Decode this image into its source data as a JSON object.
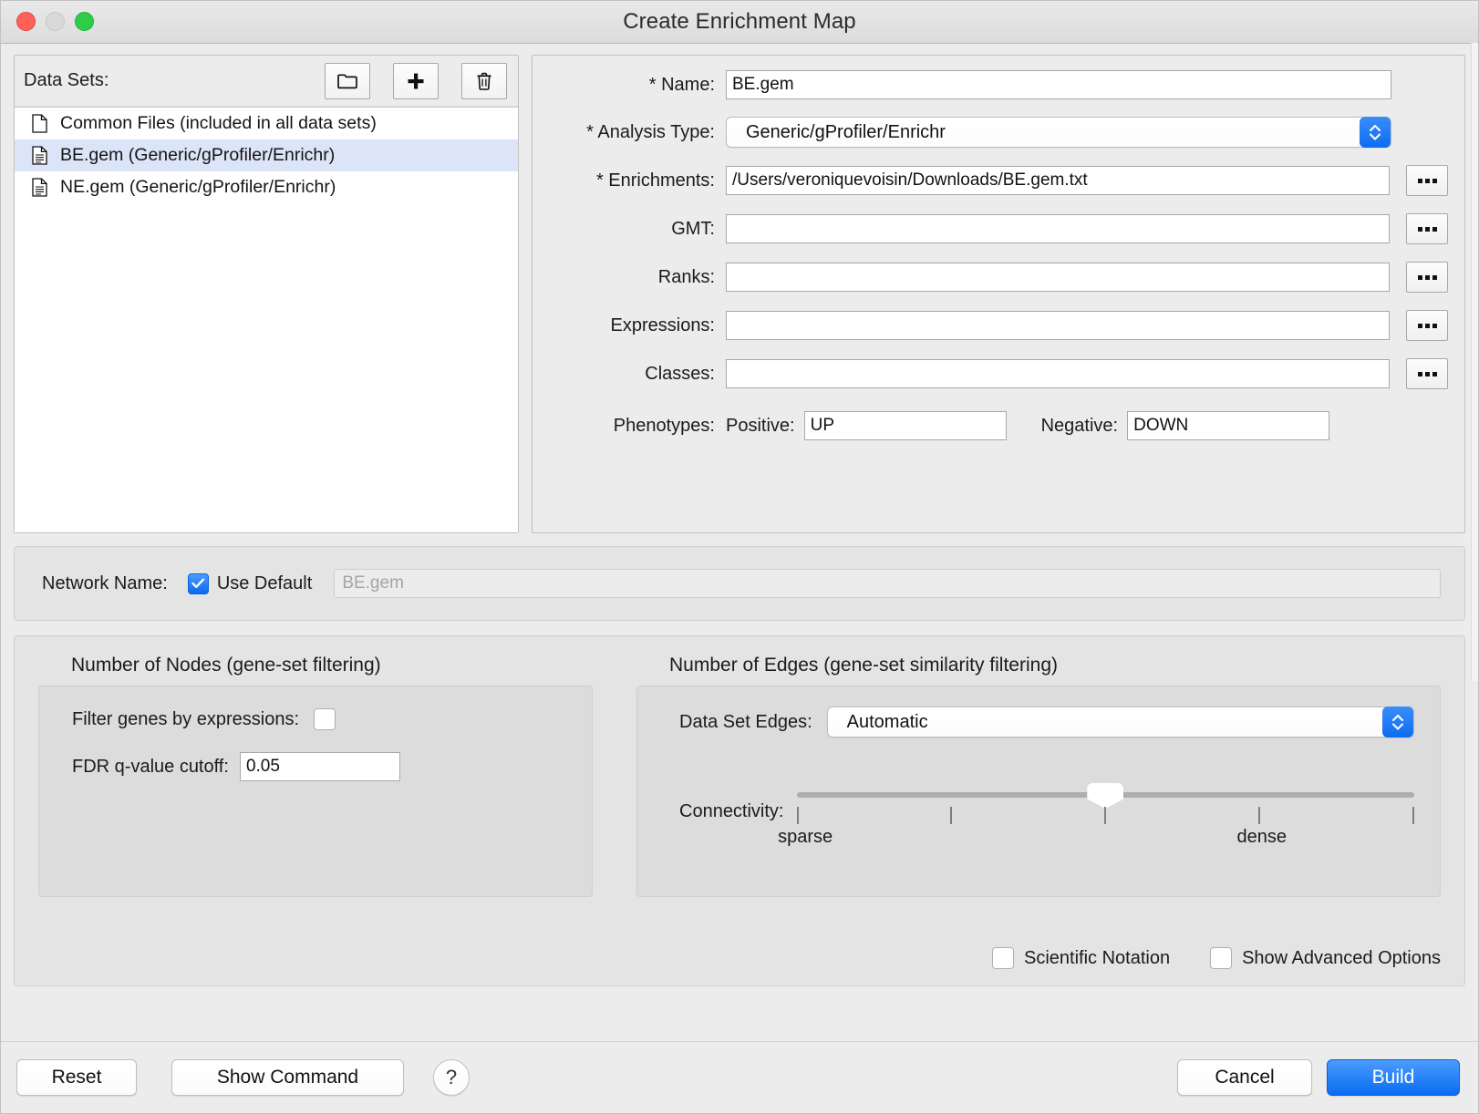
{
  "window": {
    "title": "Create Enrichment Map",
    "traffic_lights": [
      "close",
      "minimize",
      "zoom"
    ]
  },
  "datasets": {
    "label": "Data Sets:",
    "toolbar": [
      {
        "name": "open-folder-button",
        "icon": "folder-icon"
      },
      {
        "name": "add-dataset-button",
        "icon": "plus-icon"
      },
      {
        "name": "delete-dataset-button",
        "icon": "trash-icon"
      }
    ],
    "items": [
      {
        "label": "Common Files (included in all data sets)",
        "icon": "blank-file-icon",
        "selected": false
      },
      {
        "label": "BE.gem  (Generic/gProfiler/Enrichr)",
        "icon": "text-file-icon",
        "selected": true
      },
      {
        "label": "NE.gem  (Generic/gProfiler/Enrichr)",
        "icon": "text-file-icon",
        "selected": false
      }
    ]
  },
  "form": {
    "name": {
      "label": "* Name:",
      "value": "BE.gem"
    },
    "analysis_type": {
      "label": "* Analysis Type:",
      "value": "Generic/gProfiler/Enrichr",
      "options": [
        "Generic/gProfiler/Enrichr"
      ]
    },
    "enrichments": {
      "label": "* Enrichments:",
      "value": "/Users/veroniquevoisin/Downloads/BE.gem.txt",
      "browse": "..."
    },
    "gmt": {
      "label": "GMT:",
      "value": "",
      "browse": "..."
    },
    "ranks": {
      "label": "Ranks:",
      "value": "",
      "browse": "..."
    },
    "expressions": {
      "label": "Expressions:",
      "value": "",
      "browse": "..."
    },
    "classes": {
      "label": "Classes:",
      "value": "",
      "browse": "..."
    },
    "phenotypes": {
      "label": "Phenotypes:",
      "positive_label": "Positive:",
      "positive_value": "UP",
      "negative_label": "Negative:",
      "negative_value": "DOWN"
    }
  },
  "network_name": {
    "label": "Network Name:",
    "use_default_label": "Use Default",
    "use_default_checked": true,
    "placeholder": "BE.gem",
    "value": ""
  },
  "nodes_section": {
    "title": "Number of Nodes (gene-set filtering)",
    "filter_genes_label": "Filter genes by expressions:",
    "filter_genes_checked": false,
    "fdr_label": "FDR q-value cutoff:",
    "fdr_value": "0.05"
  },
  "edges_section": {
    "title": "Number of Edges (gene-set similarity filtering)",
    "dataset_edges_label": "Data Set Edges:",
    "dataset_edges_value": "Automatic",
    "dataset_edges_options": [
      "Automatic"
    ],
    "connectivity_label": "Connectivity:",
    "connectivity_min_label": "sparse",
    "connectivity_max_label": "dense",
    "connectivity_value": 50,
    "connectivity_ticks": 5
  },
  "bottom_options": {
    "scientific_notation_label": "Scientific Notation",
    "scientific_notation_checked": false,
    "show_advanced_label": "Show Advanced Options",
    "show_advanced_checked": false
  },
  "footer": {
    "reset": "Reset",
    "show_command": "Show Command",
    "help": "?",
    "cancel": "Cancel",
    "build": "Build"
  },
  "colors": {
    "accent_blue": "#0a6cf2",
    "selection_blue": "#dce4f7",
    "window_bg": "#ececec"
  }
}
